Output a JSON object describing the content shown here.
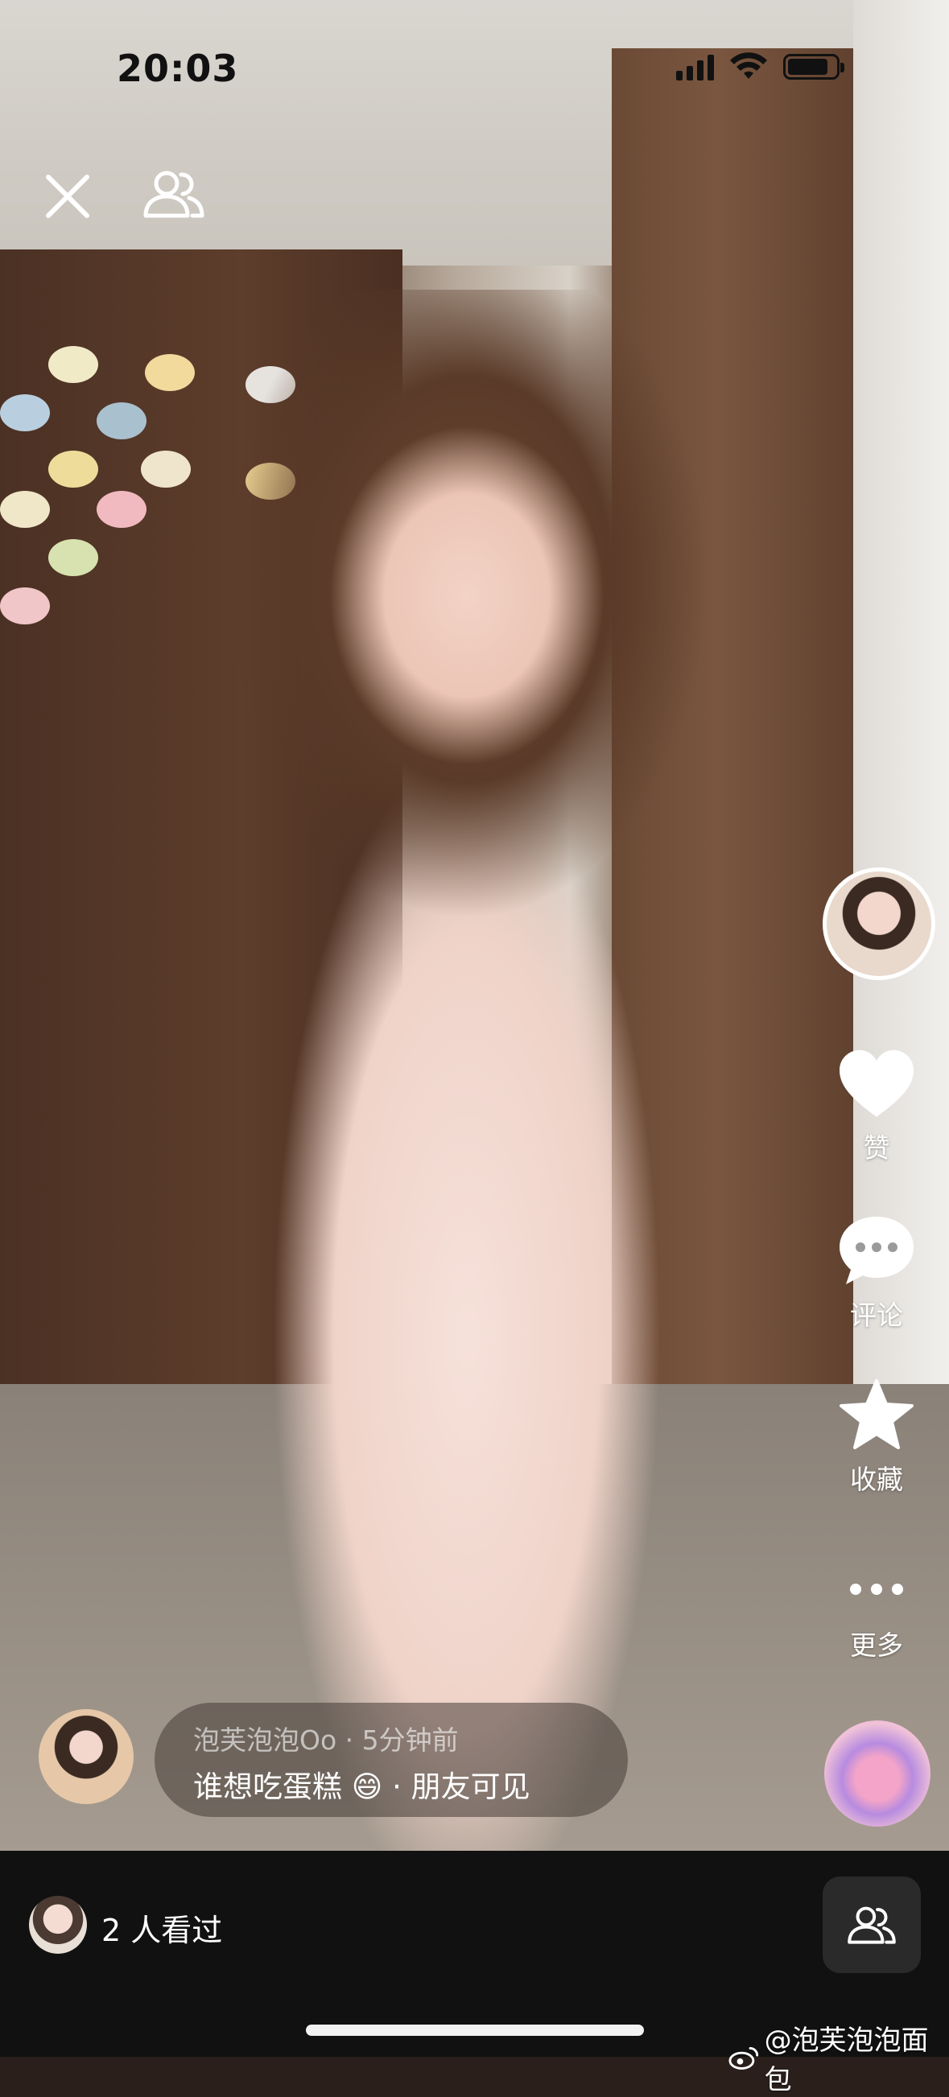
{
  "status_bar": {
    "time": "20:03",
    "battery_level": 0.85
  },
  "top_bar": {
    "close_icon": "close-x-icon",
    "friends_icon": "people-icon"
  },
  "actions": {
    "like_label": "赞",
    "comment_label": "评论",
    "favorite_label": "收藏",
    "more_label": "更多"
  },
  "comment": {
    "author": "泡芙泡泡Oo",
    "time": "5分钟前",
    "meta": "泡芙泡泡Oo · 5分钟前",
    "text": "谁想吃蛋糕",
    "emoji": "😄",
    "visibility": "· 朋友可见"
  },
  "bottom_bar": {
    "viewers_text": "2 人看过"
  },
  "watermark": {
    "text": "@泡芙泡泡面包",
    "icon": "weibo-icon"
  },
  "colors": {
    "bottom_bar_bg": "#111111",
    "rail_icon": "#ffffff"
  }
}
